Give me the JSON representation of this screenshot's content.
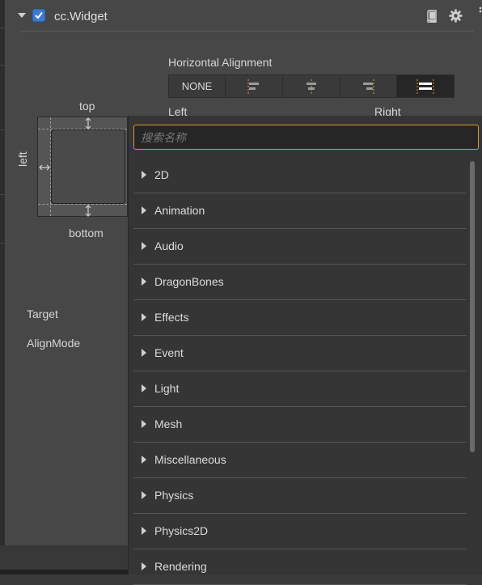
{
  "component": {
    "title": "cc.Widget",
    "enabled": true
  },
  "horizontal_alignment": {
    "label": "Horizontal Alignment",
    "options": [
      "NONE"
    ],
    "left_label": "Left",
    "right_label": "Right"
  },
  "diagram": {
    "top": "top",
    "left": "left",
    "bottom": "bottom"
  },
  "properties": {
    "target": "Target",
    "align_mode": "AlignMode"
  },
  "popup": {
    "search_placeholder": "搜索名称",
    "items": [
      "2D",
      "Animation",
      "Audio",
      "DragonBones",
      "Effects",
      "Event",
      "Light",
      "Mesh",
      "Miscellaneous",
      "Physics",
      "Physics2D",
      "Rendering"
    ]
  },
  "colors": {
    "accent": "#d99a29",
    "checkbox": "#3d7ad6"
  }
}
